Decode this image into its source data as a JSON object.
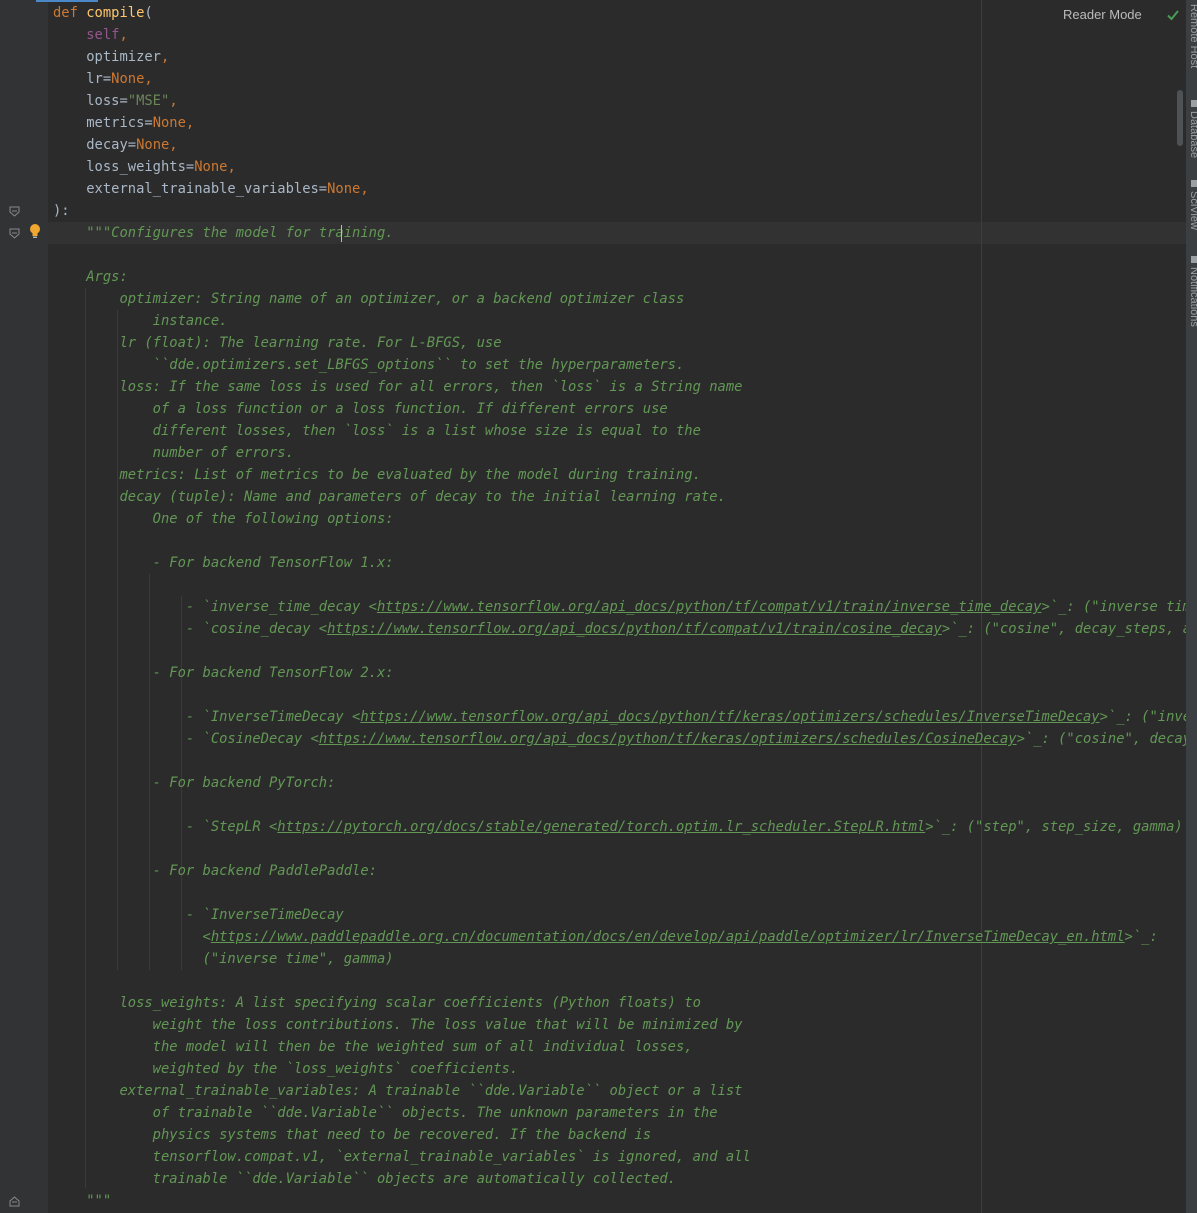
{
  "toolbar": {
    "reader_mode_label": "Reader Mode"
  },
  "side_tabs": [
    "Remote Host",
    "Database",
    "SciView",
    "Notifications"
  ],
  "code_lines": [
    [
      [
        "kw",
        "def "
      ],
      [
        "fn",
        "compile"
      ],
      [
        "p",
        "("
      ]
    ],
    [
      [
        "p",
        "    "
      ],
      [
        "self",
        "self"
      ],
      [
        "kw",
        ","
      ]
    ],
    [
      [
        "p",
        "    optimizer"
      ],
      [
        "kw",
        ","
      ]
    ],
    [
      [
        "p",
        "    lr="
      ],
      [
        "kw",
        "None,"
      ]
    ],
    [
      [
        "p",
        "    loss="
      ],
      [
        "str",
        "\"MSE\""
      ],
      [
        "kw",
        ","
      ]
    ],
    [
      [
        "p",
        "    metrics="
      ],
      [
        "kw",
        "None,"
      ]
    ],
    [
      [
        "p",
        "    decay="
      ],
      [
        "kw",
        "None,"
      ]
    ],
    [
      [
        "p",
        "    loss_weights="
      ],
      [
        "kw",
        "None,"
      ]
    ],
    [
      [
        "p",
        "    external_trainable_variables="
      ],
      [
        "kw",
        "None,"
      ]
    ],
    [
      [
        "p",
        "):"
      ]
    ],
    [
      [
        "doc",
        "    \"\"\"Configures the model for training."
      ]
    ],
    [],
    [
      [
        "doc",
        "    Args:"
      ]
    ],
    [
      [
        "doc",
        "        optimizer: String name of an optimizer, or a backend optimizer class"
      ]
    ],
    [
      [
        "doc",
        "            instance."
      ]
    ],
    [
      [
        "doc",
        "        lr (float): The learning rate. For L-BFGS, use"
      ]
    ],
    [
      [
        "doc",
        "            ``dde.optimizers.set_LBFGS_options`` to set the hyperparameters."
      ]
    ],
    [
      [
        "doc",
        "        loss: If the same loss is used for all errors, then `loss` is a String name"
      ]
    ],
    [
      [
        "doc",
        "            of a loss function or a loss function. If different errors use"
      ]
    ],
    [
      [
        "doc",
        "            different losses, then `loss` is a list whose size is equal to the"
      ]
    ],
    [
      [
        "doc",
        "            number of errors."
      ]
    ],
    [
      [
        "doc",
        "        metrics: List of metrics to be evaluated by the model during training."
      ]
    ],
    [
      [
        "doc",
        "        decay (tuple): Name and parameters of decay to the initial learning rate."
      ]
    ],
    [
      [
        "doc",
        "            One of the following options:"
      ]
    ],
    [],
    [
      [
        "doc",
        "            - For backend TensorFlow 1.x:"
      ]
    ],
    [],
    [
      [
        "doc",
        "                - `inverse_time_decay <"
      ],
      [
        "lnk",
        "https://www.tensorflow.org/api_docs/python/tf/compat/v1/train/inverse_time_decay"
      ],
      [
        "doc",
        ">`_: (\"inverse time\", d"
      ]
    ],
    [
      [
        "doc",
        "                - `cosine_decay <"
      ],
      [
        "lnk",
        "https://www.tensorflow.org/api_docs/python/tf/compat/v1/train/cosine_decay"
      ],
      [
        "doc",
        ">`_: (\"cosine\", decay_steps, alpha)"
      ]
    ],
    [],
    [
      [
        "doc",
        "            - For backend TensorFlow 2.x:"
      ]
    ],
    [],
    [
      [
        "doc",
        "                - `InverseTimeDecay <"
      ],
      [
        "lnk",
        "https://www.tensorflow.org/api_docs/python/tf/keras/optimizers/schedules/InverseTimeDecay"
      ],
      [
        "doc",
        ">`_: (\"inverse t"
      ]
    ],
    [
      [
        "doc",
        "                - `CosineDecay <"
      ],
      [
        "lnk",
        "https://www.tensorflow.org/api_docs/python/tf/keras/optimizers/schedules/CosineDecay"
      ],
      [
        "doc",
        ">`_: (\"cosine\", decay_step"
      ]
    ],
    [],
    [
      [
        "doc",
        "            - For backend PyTorch:"
      ]
    ],
    [],
    [
      [
        "doc",
        "                - `StepLR <"
      ],
      [
        "lnk",
        "https://pytorch.org/docs/stable/generated/torch.optim.lr_scheduler.StepLR.html"
      ],
      [
        "doc",
        ">`_: (\"step\", step_size, gamma)"
      ]
    ],
    [],
    [
      [
        "doc",
        "            - For backend PaddlePaddle:"
      ]
    ],
    [],
    [
      [
        "doc",
        "                - `InverseTimeDecay"
      ]
    ],
    [
      [
        "doc",
        "                  <"
      ],
      [
        "lnk",
        "https://www.paddlepaddle.org.cn/documentation/docs/en/develop/api/paddle/optimizer/lr/InverseTimeDecay_en.html"
      ],
      [
        "doc",
        ">`_:"
      ]
    ],
    [
      [
        "doc",
        "                  (\"inverse time\", gamma)"
      ]
    ],
    [],
    [
      [
        "doc",
        "        loss_weights: A list specifying scalar coefficients (Python floats) to"
      ]
    ],
    [
      [
        "doc",
        "            weight the loss contributions. The loss value that will be minimized by"
      ]
    ],
    [
      [
        "doc",
        "            the model will then be the weighted sum of all individual losses,"
      ]
    ],
    [
      [
        "doc",
        "            weighted by the `loss_weights` coefficients."
      ]
    ],
    [
      [
        "doc",
        "        external_trainable_variables: A trainable ``dde.Variable`` object or a list"
      ]
    ],
    [
      [
        "doc",
        "            of trainable ``dde.Variable`` objects. The unknown parameters in the"
      ]
    ],
    [
      [
        "doc",
        "            physics systems that need to be recovered. If the backend is"
      ]
    ],
    [
      [
        "doc",
        "            tensorflow.compat.v1, `external_trainable_variables` is ignored, and all"
      ]
    ],
    [
      [
        "doc",
        "            trainable ``dde.Variable`` objects are automatically collected."
      ]
    ],
    [
      [
        "doc",
        "    \"\"\""
      ]
    ]
  ]
}
